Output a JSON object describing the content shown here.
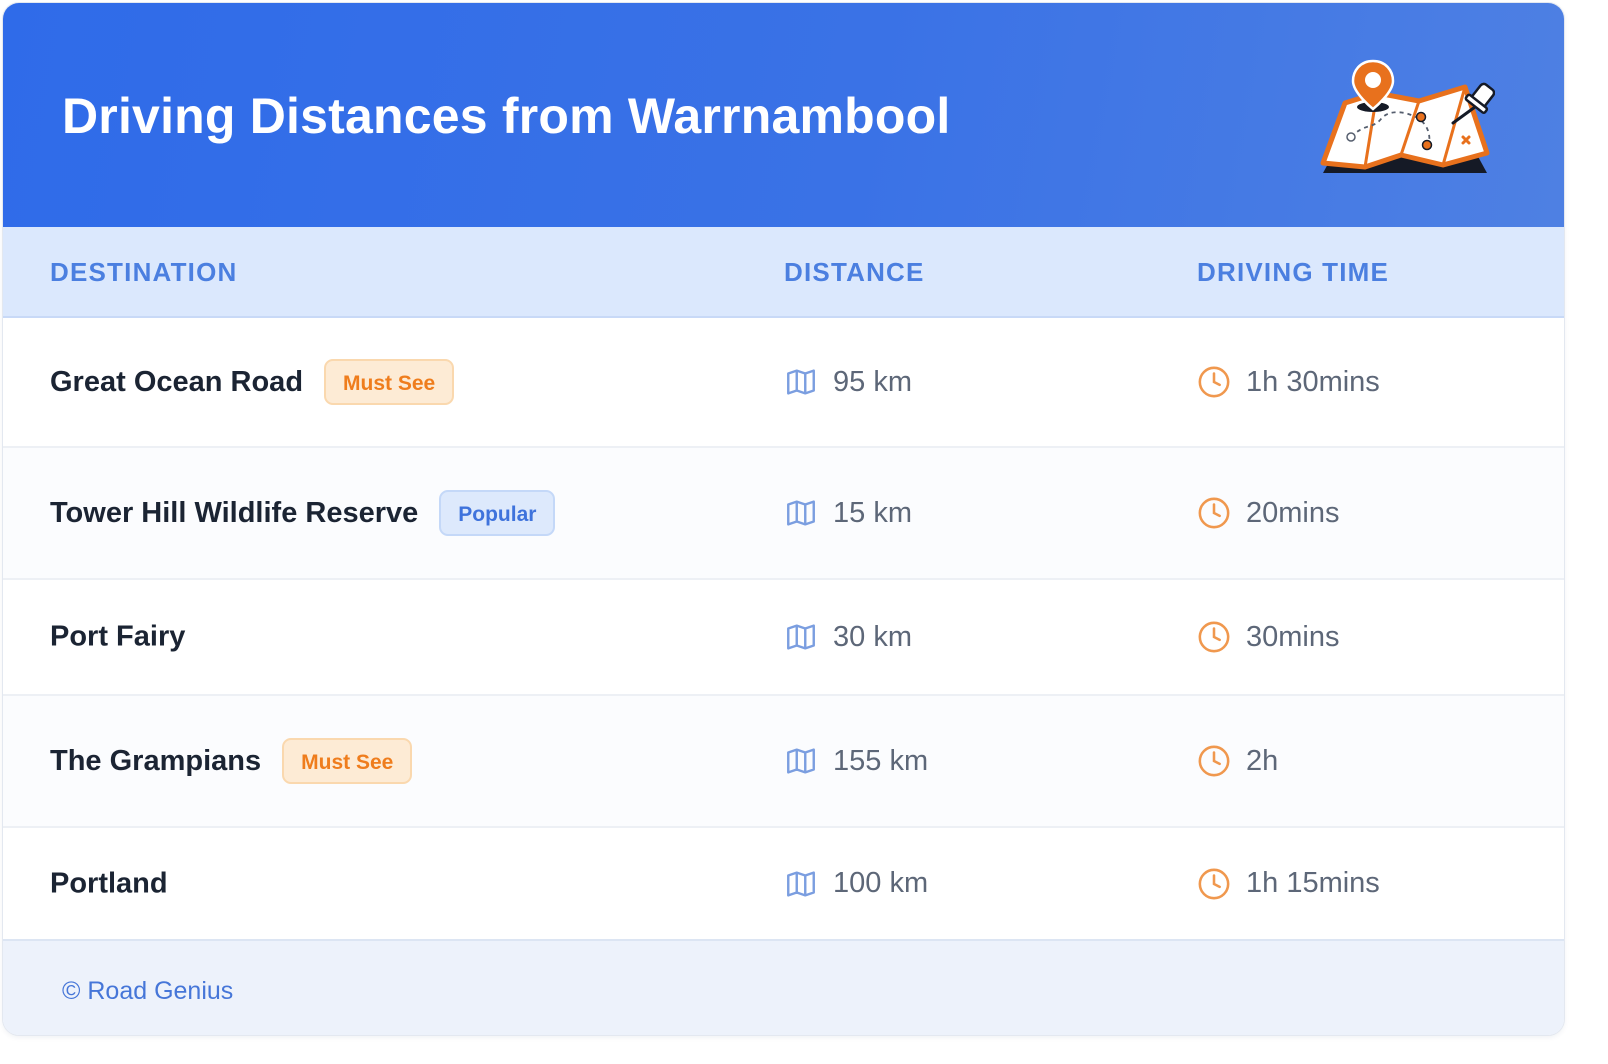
{
  "header": {
    "title": "Driving Distances from Warrnambool"
  },
  "columns": {
    "destination": "DESTINATION",
    "distance": "DISTANCE",
    "driving_time": "DRIVING TIME"
  },
  "rows": [
    {
      "destination": "Great Ocean Road",
      "badge": "Must See",
      "badge_color": "orange",
      "distance": "95 km",
      "time": "1h 30mins"
    },
    {
      "destination": "Tower Hill Wildlife Reserve",
      "badge": "Popular",
      "badge_color": "blue",
      "distance": "15 km",
      "time": "20mins"
    },
    {
      "destination": "Port Fairy",
      "badge": "",
      "badge_color": "",
      "distance": "30 km",
      "time": "30mins"
    },
    {
      "destination": "The Grampians",
      "badge": "Must See",
      "badge_color": "orange",
      "distance": "155 km",
      "time": "2h"
    },
    {
      "destination": "Portland",
      "badge": "",
      "badge_color": "",
      "distance": "100 km",
      "time": "1h 15mins"
    }
  ],
  "icons": {
    "header": "map-with-pins-icon",
    "distance": "map-icon",
    "time": "clock-icon"
  },
  "colors": {
    "header_blue": "#2f6be9",
    "accent_orange": "#ef7d1d",
    "column_header_blue": "#4b7fe0"
  },
  "footer": {
    "text": "© Road Genius"
  }
}
